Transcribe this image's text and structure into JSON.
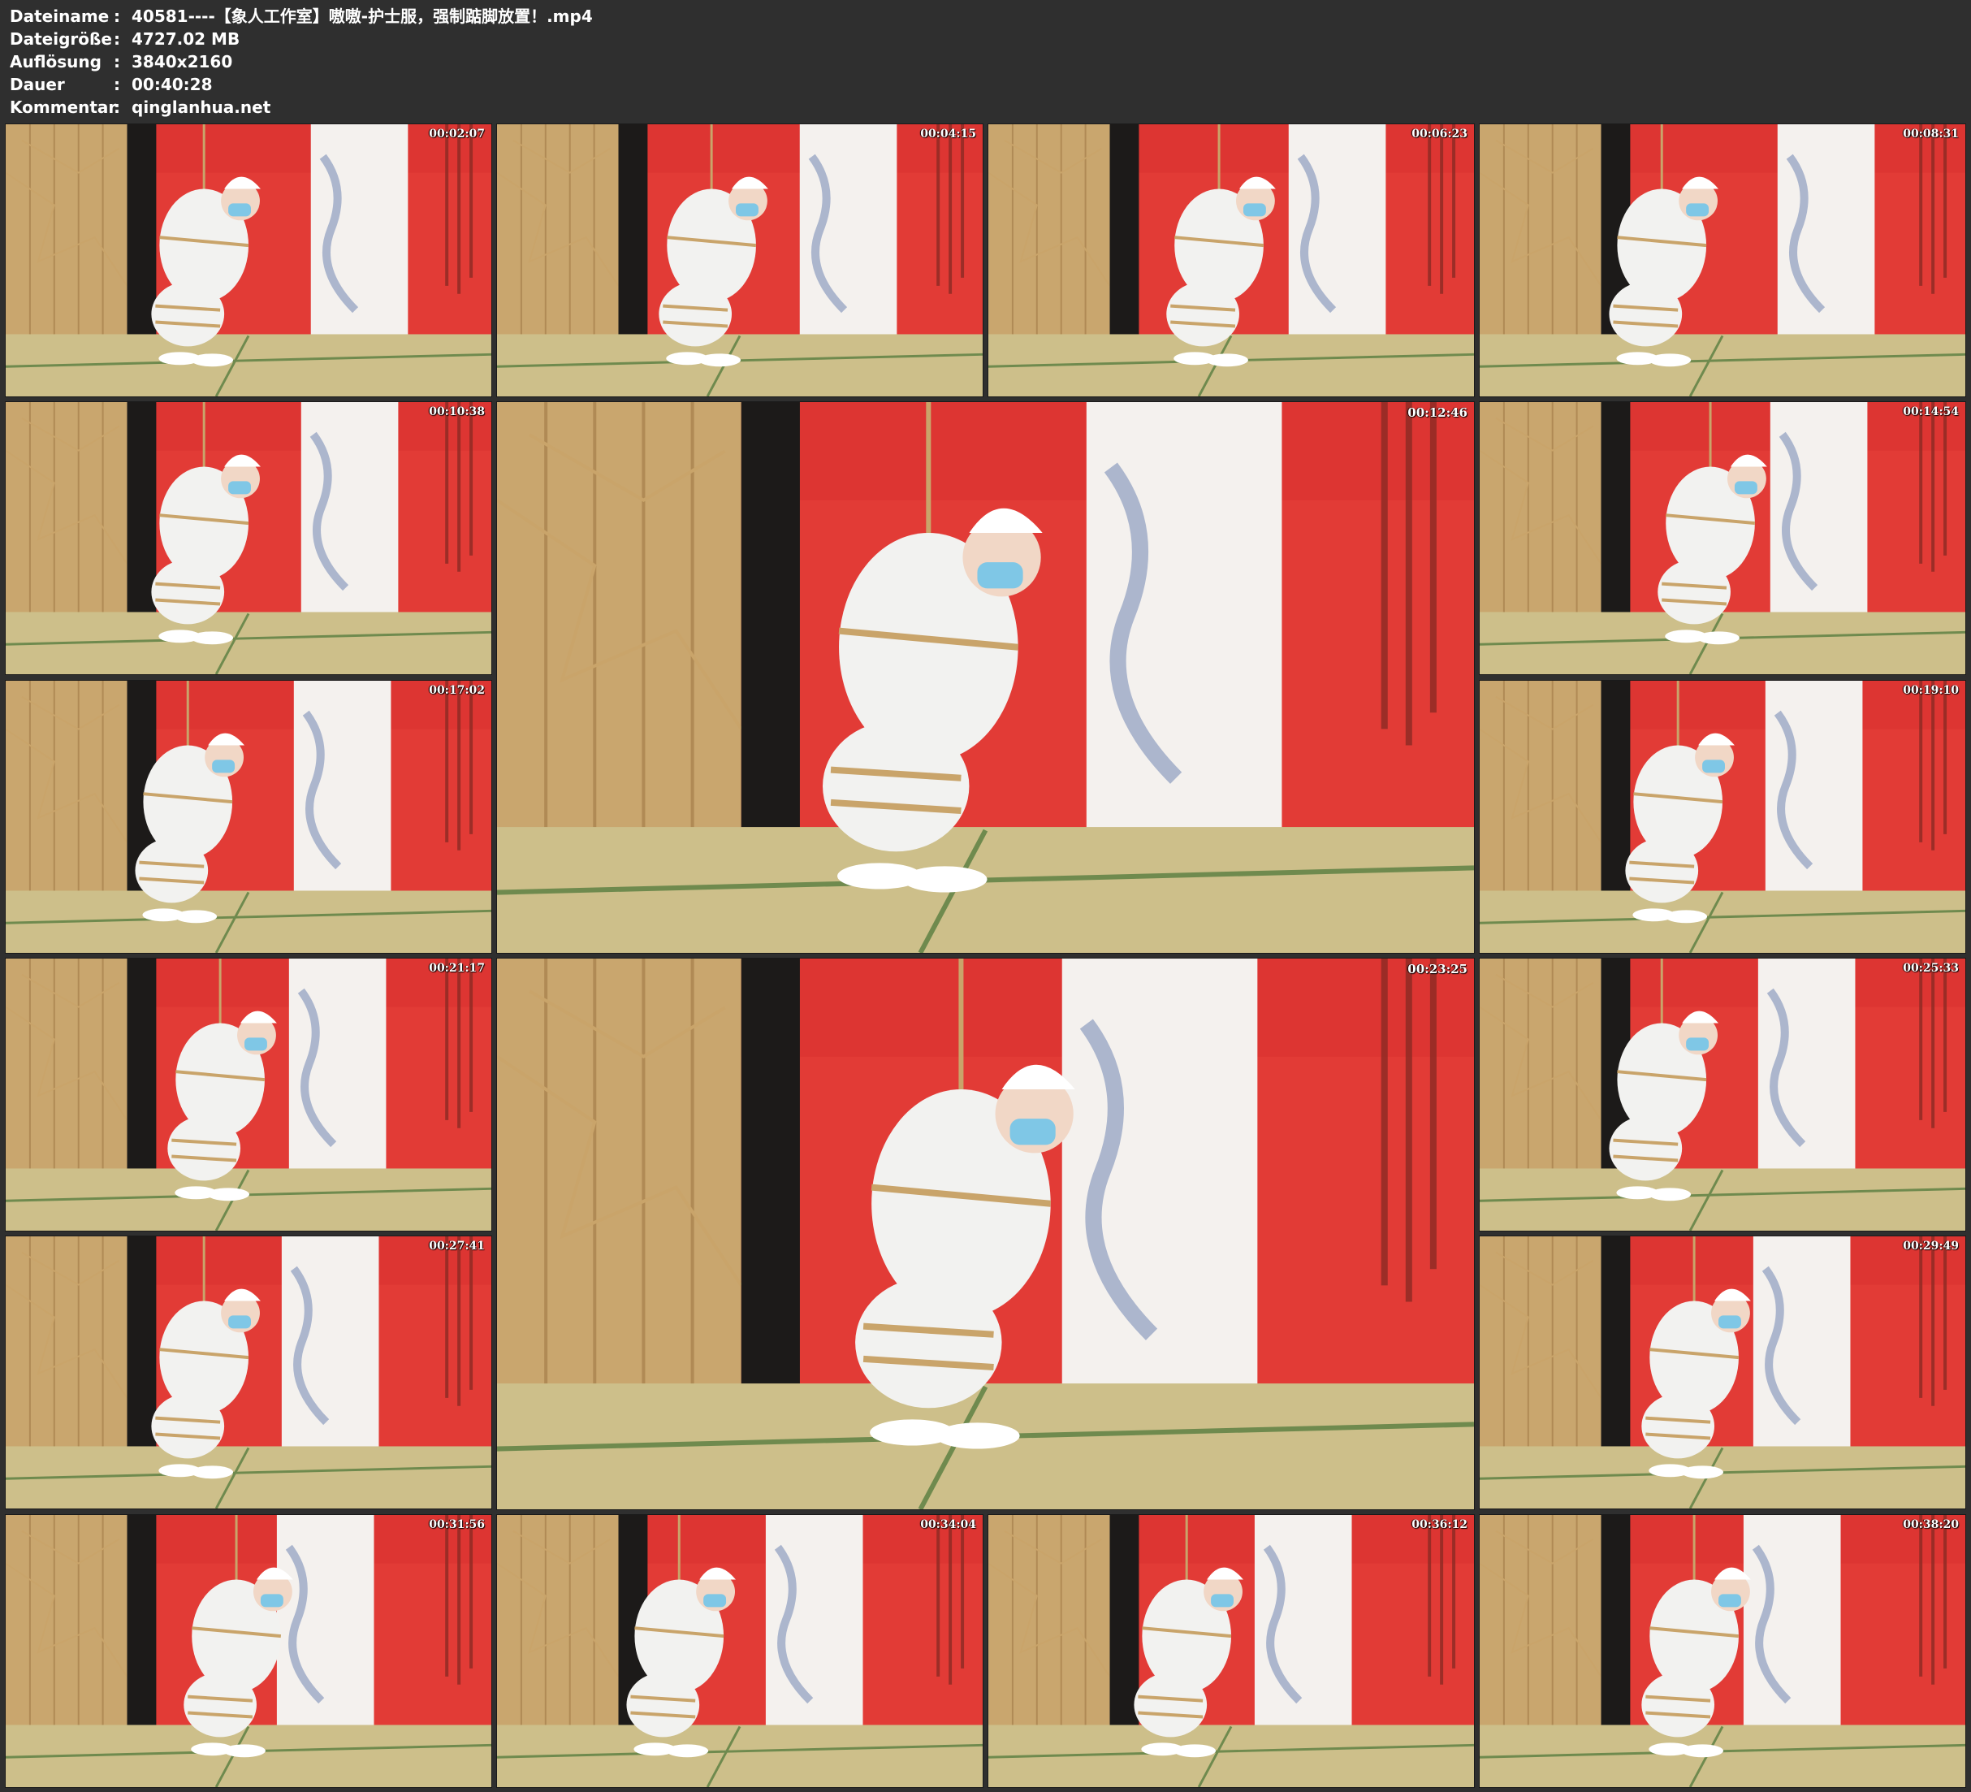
{
  "info": {
    "fields": [
      {
        "label": "Dateiname",
        "value": "40581----【象人工作室】嗷嗷-护士服，强制踮脚放置！.mp4"
      },
      {
        "label": "Dateigröße",
        "value": "4727.02 MB"
      },
      {
        "label": "Auflösung",
        "value": "3840x2160"
      },
      {
        "label": "Dauer",
        "value": "00:40:28"
      },
      {
        "label": "Kommentar",
        "value": "qinglanhua.net"
      }
    ],
    "separator": ":"
  },
  "thumbnails": [
    {
      "timestamp": "00:02:07"
    },
    {
      "timestamp": "00:04:15"
    },
    {
      "timestamp": "00:06:23"
    },
    {
      "timestamp": "00:08:31"
    },
    {
      "timestamp": "00:10:38"
    },
    {
      "timestamp": "00:12:46"
    },
    {
      "timestamp": "00:14:54"
    },
    {
      "timestamp": "00:17:02"
    },
    {
      "timestamp": "00:19:10"
    },
    {
      "timestamp": "00:21:17"
    },
    {
      "timestamp": "00:23:25"
    },
    {
      "timestamp": "00:25:33"
    },
    {
      "timestamp": "00:27:41"
    },
    {
      "timestamp": "00:29:49"
    },
    {
      "timestamp": "00:31:56"
    },
    {
      "timestamp": "00:34:04"
    },
    {
      "timestamp": "00:36:12"
    },
    {
      "timestamp": "00:38:20"
    }
  ],
  "colors": {
    "background": "#2f2f2f",
    "wall_red": "#e23b36",
    "floor_tatami": "#cdbf8a",
    "screen_wood": "#c9a66e",
    "rope": "#c9a46a",
    "uniform_white": "#f2f2f0"
  }
}
